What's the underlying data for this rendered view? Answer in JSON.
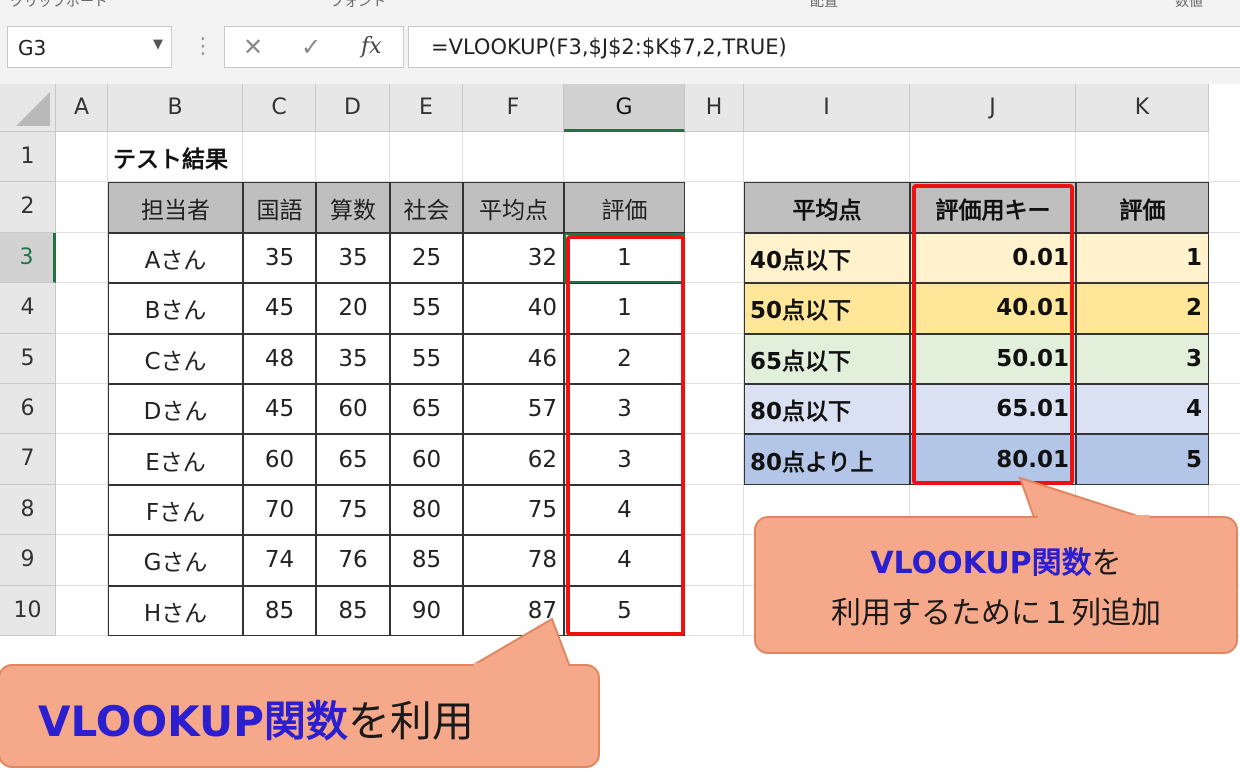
{
  "ribbon_labels": [
    "クリップボード",
    "フォント",
    "配置",
    "数値"
  ],
  "name_box": "G3",
  "formula_bar": {
    "formula": "=VLOOKUP(F3,$J$2:$K$7,2,TRUE)",
    "fx_label": "fx",
    "cancel_label": "✕",
    "enter_label": "✓"
  },
  "columns": [
    "A",
    "B",
    "C",
    "D",
    "E",
    "F",
    "G",
    "H",
    "I",
    "J",
    "K"
  ],
  "rows": [
    "1",
    "2",
    "3",
    "4",
    "5",
    "6",
    "7",
    "8",
    "9",
    "10"
  ],
  "left_table": {
    "title": "テスト結果",
    "headers": [
      "担当者",
      "国語",
      "算数",
      "社会",
      "平均点",
      "評価"
    ],
    "rows": [
      [
        "Aさん",
        "35",
        "35",
        "25",
        "32",
        "1"
      ],
      [
        "Bさん",
        "45",
        "20",
        "55",
        "40",
        "1"
      ],
      [
        "Cさん",
        "48",
        "35",
        "55",
        "46",
        "2"
      ],
      [
        "Dさん",
        "45",
        "60",
        "65",
        "57",
        "3"
      ],
      [
        "Eさん",
        "60",
        "65",
        "60",
        "62",
        "3"
      ],
      [
        "Fさん",
        "70",
        "75",
        "80",
        "75",
        "4"
      ],
      [
        "Gさん",
        "74",
        "76",
        "85",
        "78",
        "4"
      ],
      [
        "Hさん",
        "85",
        "85",
        "90",
        "87",
        "5"
      ]
    ]
  },
  "right_table": {
    "headers": [
      "平均点",
      "評価用キー",
      "評価"
    ],
    "rows": [
      {
        "label": "40点以下",
        "key": "0.01",
        "grade": "1",
        "color": "#fff2cc"
      },
      {
        "label": "50点以下",
        "key": "40.01",
        "grade": "2",
        "color": "#ffe699"
      },
      {
        "label": "65点以下",
        "key": "50.01",
        "grade": "3",
        "color": "#e2efda"
      },
      {
        "label": "80点以下",
        "key": "65.01",
        "grade": "4",
        "color": "#d9e1f2"
      },
      {
        "label": "80点より上",
        "key": "80.01",
        "grade": "5",
        "color": "#b4c6e7"
      }
    ]
  },
  "callout_right": {
    "line1_bold": "VLOOKUP関数",
    "line1_rest": "を",
    "line2": "利用するために１列追加"
  },
  "callout_bottom": {
    "bold": "VLOOKUP関数",
    "rest": "を利用"
  },
  "colors": {
    "highlight_red": "#ee1111",
    "callout_fill": "#f5a98a",
    "callout_text_blue": "#2b1fcf",
    "excel_green": "#217346"
  }
}
